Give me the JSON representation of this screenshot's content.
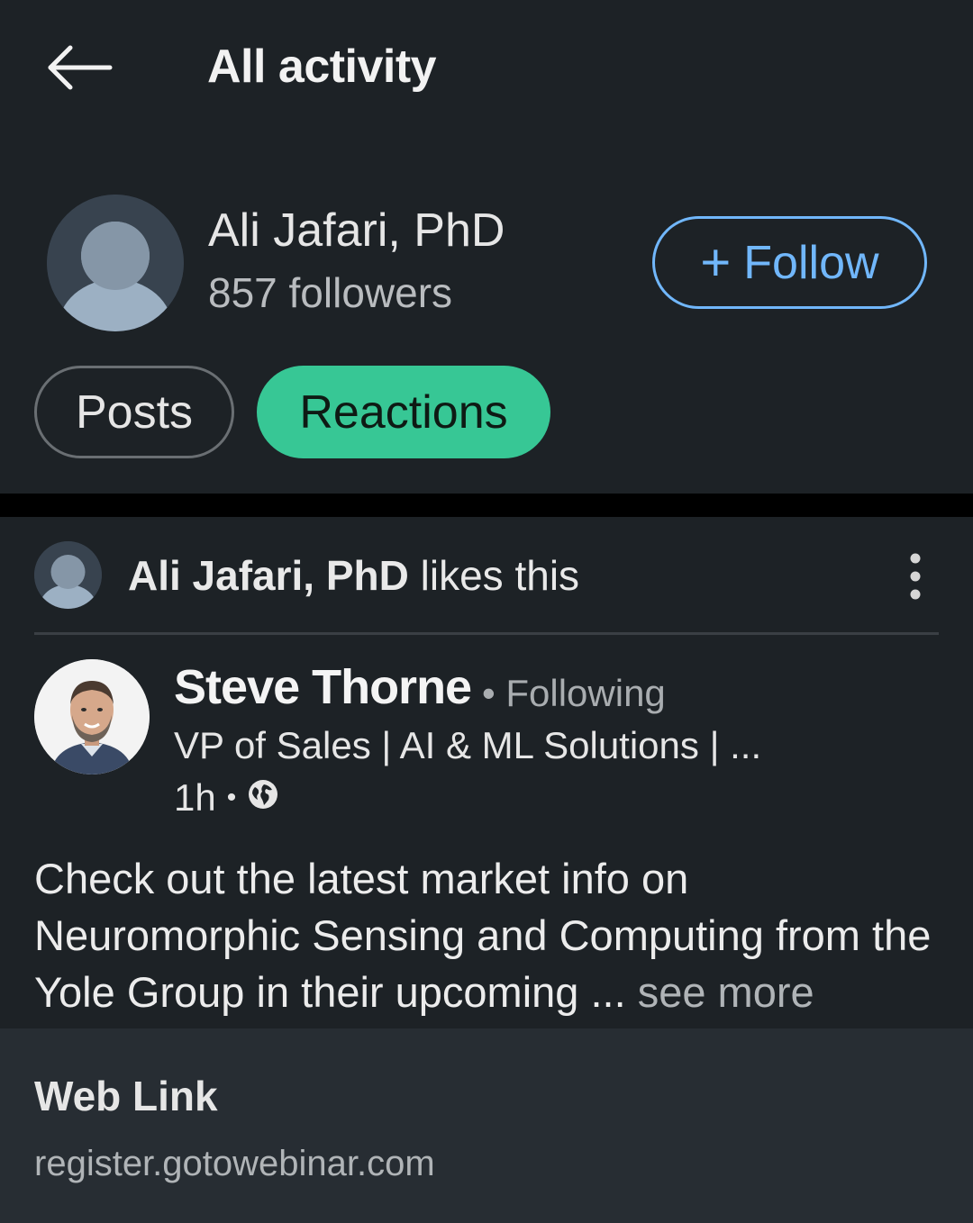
{
  "header": {
    "title": "All activity"
  },
  "profile": {
    "name": "Ali Jafari, PhD",
    "followers": "857 followers",
    "follow_plus": "+",
    "follow_label": "Follow"
  },
  "tabs": [
    {
      "label": "Posts",
      "selected": false
    },
    {
      "label": "Reactions",
      "selected": true
    }
  ],
  "activity": {
    "actor": "Ali Jafari, PhD",
    "action": "likes this"
  },
  "post": {
    "author": "Steve Thorne",
    "follow_status": "• Following",
    "headline": "VP of Sales | AI & ML Solutions | ...",
    "time": "1h",
    "separator": "•",
    "body": "Check out the latest market info on Neuromorphic Sensing and Computing from the Yole Group in their upcoming ...",
    "see_more": "see more"
  },
  "web_link": {
    "title": "Web Link",
    "url": "register.gotowebinar.com"
  },
  "colors": {
    "background": "#1d2226",
    "accent_blue": "#71b7fb",
    "selected_tab": "#37c795",
    "link_card": "#272d33"
  }
}
